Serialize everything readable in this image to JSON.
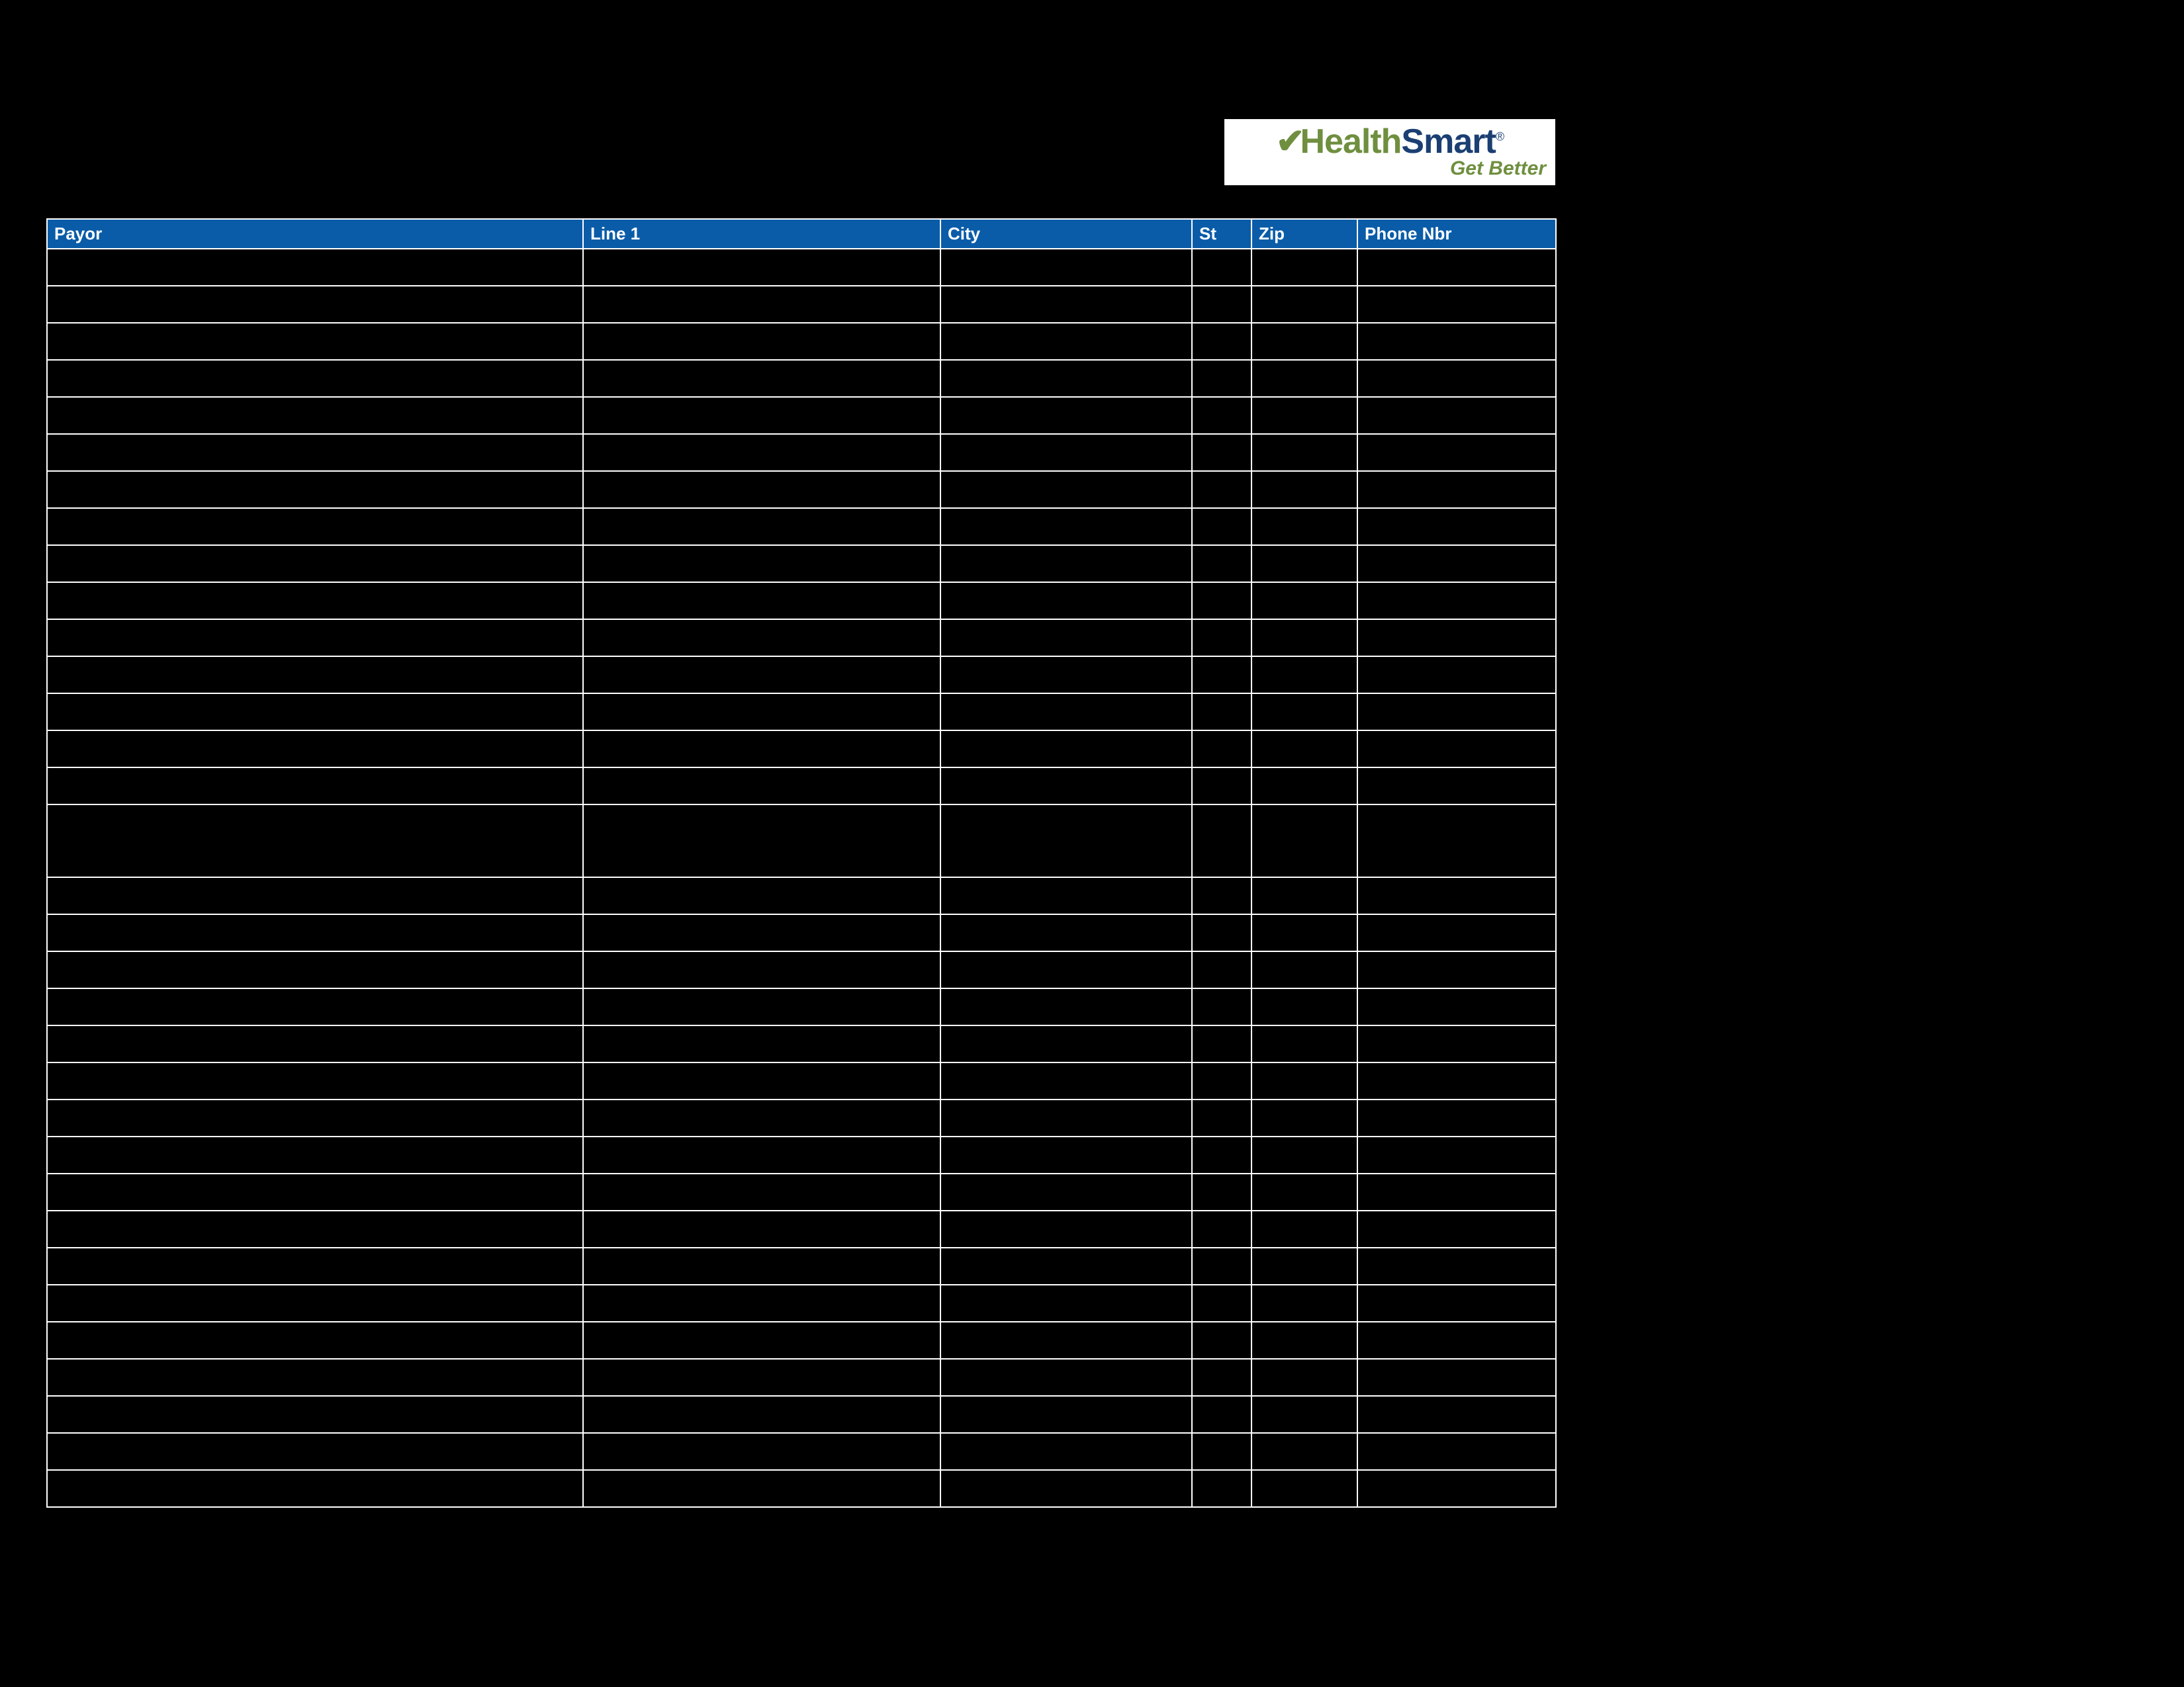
{
  "logo": {
    "word1": "Health",
    "word2": "Smart",
    "tagline": "Get Better"
  },
  "table": {
    "headers": {
      "payor": "Payor",
      "line1": "Line 1",
      "city": "City",
      "st": "St",
      "zip": "Zip",
      "phone": "Phone Nbr"
    },
    "row_count": 33,
    "tall_row_index": 15
  }
}
